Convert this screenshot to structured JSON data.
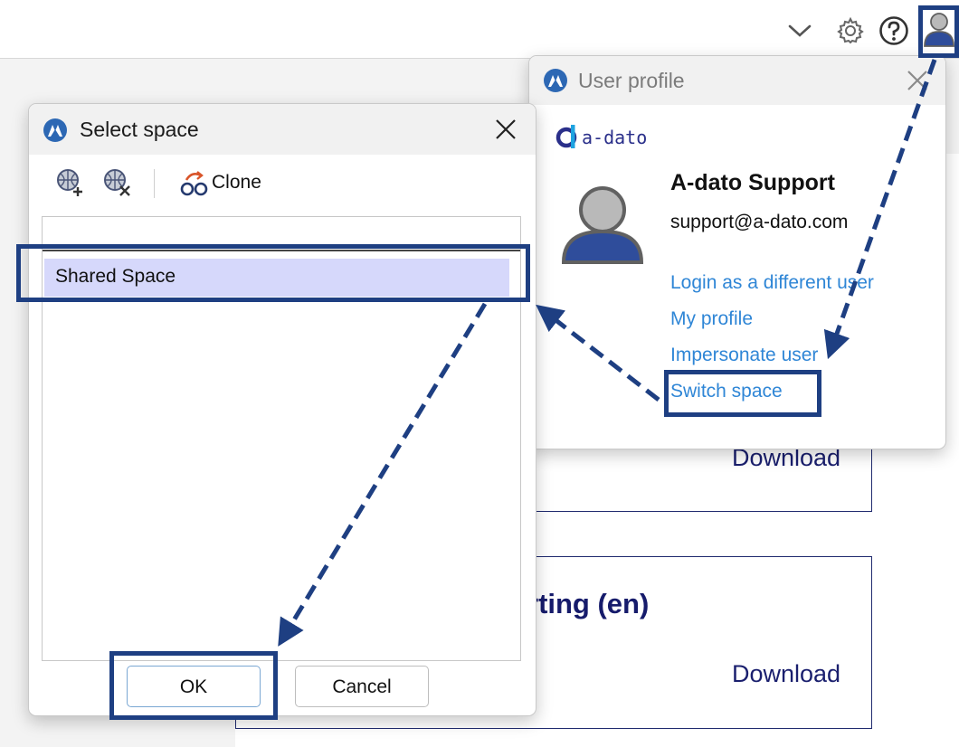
{
  "profile": {
    "title": "User profile",
    "logo_text": "a-dato",
    "user_name": "A-dato Support",
    "email": "support@a-dato.com",
    "links": {
      "login_other": "Login as a different user",
      "my_profile": "My profile",
      "impersonate": "Impersonate user",
      "switch_space": "Switch space"
    }
  },
  "select_space": {
    "title": "Select space",
    "toolbar": {
      "clone": "Clone"
    },
    "items": [
      "Shared Space"
    ],
    "ok": "OK",
    "cancel": "Cancel"
  },
  "background": {
    "download_1": "Download",
    "download_2": "Download",
    "card_title_fragment": "rting (en)"
  },
  "colors": {
    "accent": "#2f86d6",
    "highlight": "#1e3f82",
    "selection": "#d6d8fb",
    "card_text": "#1a1f6e"
  }
}
